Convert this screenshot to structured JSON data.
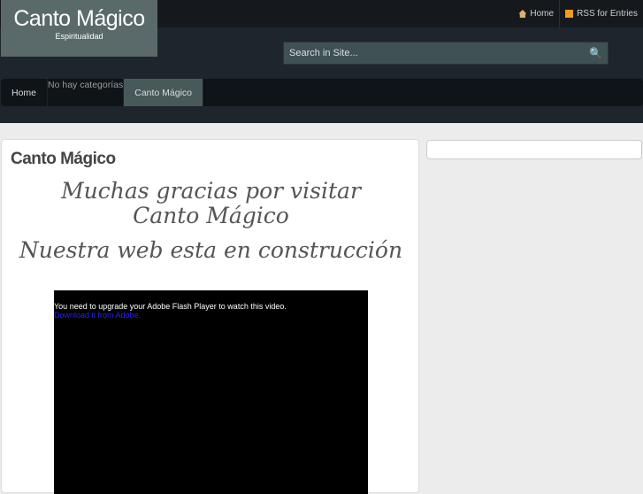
{
  "site": {
    "title": "Canto Mágico",
    "tagline": "Espiritualidad"
  },
  "toplinks": [
    {
      "label": "Home",
      "icon": "home-icon"
    },
    {
      "label": "RSS for Entries",
      "icon": "rss-icon"
    }
  ],
  "search": {
    "placeholder": "Search in Site..."
  },
  "nav": {
    "home": "Home",
    "no_categories": "No hay categorías",
    "active": "Canto Mágico"
  },
  "post": {
    "title": "Canto Mágico",
    "line1": "Muchas gracias por visitar  Canto Mágico",
    "line2": "Nuestra web esta en construcción"
  },
  "video": {
    "message": "You need to upgrade your Adobe Flash Player to watch this video.",
    "link": "Download it from Adobe."
  }
}
